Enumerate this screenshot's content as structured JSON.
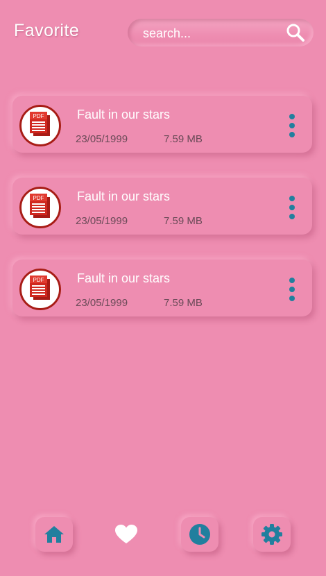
{
  "header": {
    "title": "Favorite"
  },
  "search": {
    "placeholder": "search..."
  },
  "files": [
    {
      "name": "Fault in our stars",
      "date": "23/05/1999",
      "size": "7.59 MB",
      "icon": "pdf-icon"
    },
    {
      "name": "Fault in our stars",
      "date": "23/05/1999",
      "size": "7.59 MB",
      "icon": "pdf-icon"
    },
    {
      "name": "Fault in our stars",
      "date": "23/05/1999",
      "size": "7.59 MB",
      "icon": "pdf-icon"
    }
  ],
  "nav": [
    {
      "icon": "home-icon",
      "active": false
    },
    {
      "icon": "heart-icon",
      "active": true
    },
    {
      "icon": "clock-icon",
      "active": false
    },
    {
      "icon": "gear-icon",
      "active": false
    }
  ],
  "colors": {
    "background": "#ee8db1",
    "accent": "#217f9e",
    "text": "#ffffff",
    "meta_text": "#6a4a57",
    "pdf_red": "#c8241c"
  }
}
